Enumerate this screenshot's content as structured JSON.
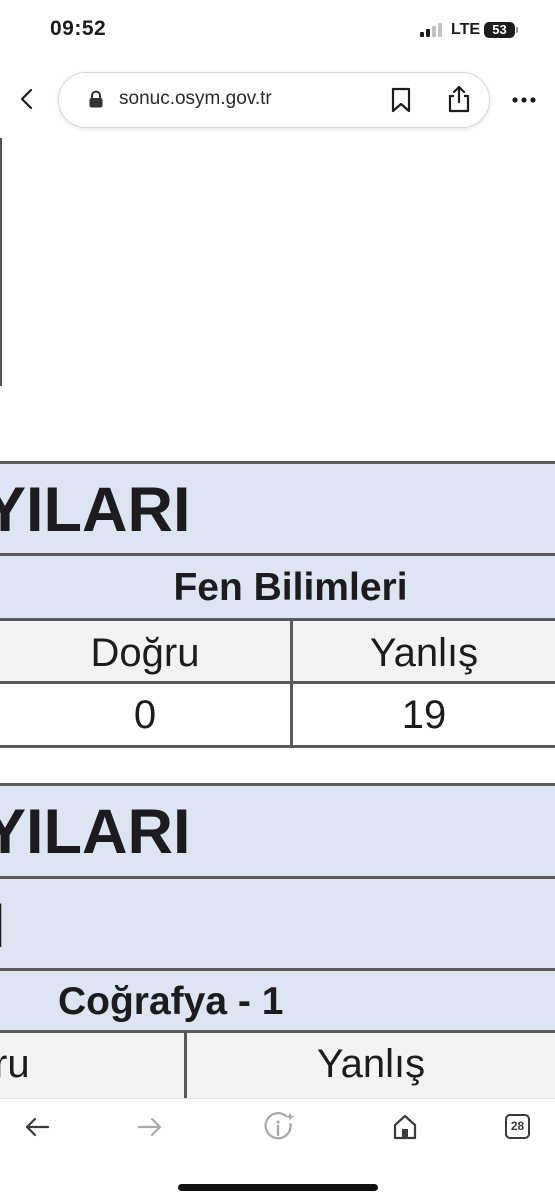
{
  "status_bar": {
    "time": "09:52",
    "network": "LTE",
    "battery": "53"
  },
  "browser": {
    "url": "sonuc.osym.gov.tr",
    "tab_count": "28"
  },
  "table1": {
    "title_fragment": "YILARI",
    "section": "Fen Bilimleri",
    "columns": [
      "Doğru",
      "Yanlış"
    ],
    "values": [
      "0",
      "19"
    ]
  },
  "table2": {
    "title_fragment": "YILARI",
    "subtitle_fragment": "I",
    "section": "Coğrafya - 1",
    "columns": [
      "ru",
      "Yanlış"
    ]
  },
  "colors": {
    "header_bg": "#dce5f1",
    "border": "#5a5a5a",
    "cell_bg": "#f3f3f3"
  },
  "icons": [
    "back-chevron-icon",
    "lock-icon",
    "bookmark-icon",
    "share-icon",
    "more-icon",
    "back-arrow-icon",
    "forward-arrow-icon",
    "page-info-icon",
    "home-icon",
    "tabs-icon"
  ]
}
